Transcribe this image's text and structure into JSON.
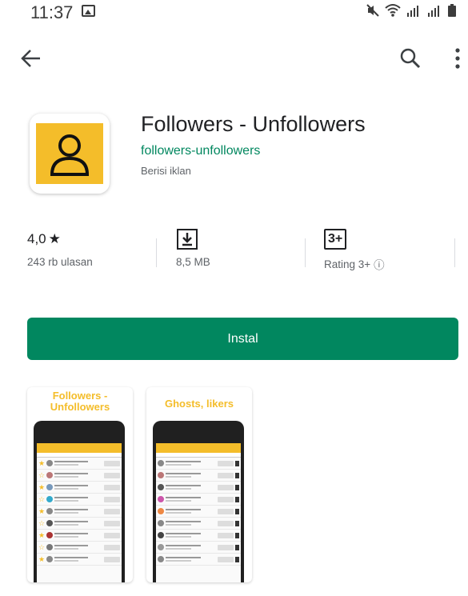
{
  "status_bar": {
    "time": "11:37"
  },
  "toolbar": {
    "back_icon": "arrow-back-icon",
    "search_icon": "search-icon",
    "more_icon": "more-vert-icon"
  },
  "app": {
    "title": "Followers - Unfollowers",
    "developer": "followers-unfollowers",
    "ads_note": "Berisi iklan",
    "icon_color": "#f4bd2a"
  },
  "stats": {
    "rating_value": "4,0",
    "rating_star": "★",
    "reviews": "243 rb ulasan",
    "size": "8,5 MB",
    "age_badge": "3+",
    "age_label": "Rating 3+",
    "info_glyph": "ⓘ"
  },
  "install": {
    "label": "Instal",
    "color": "#01875f"
  },
  "screenshots": [
    {
      "caption_line1": "Followers -",
      "caption_line2": "Unfollowers"
    },
    {
      "caption_line1": "Ghosts, likers",
      "caption_line2": ""
    }
  ]
}
